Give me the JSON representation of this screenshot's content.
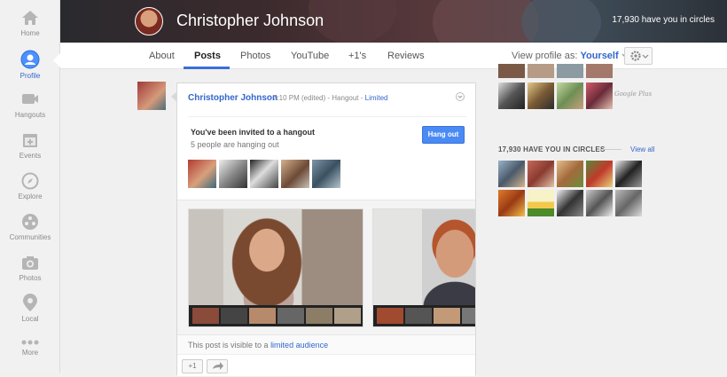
{
  "nav": {
    "items": [
      {
        "label": "Home",
        "icon": "home-icon",
        "active": false
      },
      {
        "label": "Profile",
        "icon": "profile-icon",
        "active": true
      },
      {
        "label": "Hangouts",
        "icon": "hangouts-icon",
        "active": false
      },
      {
        "label": "Events",
        "icon": "events-icon",
        "active": false
      },
      {
        "label": "Explore",
        "icon": "explore-icon",
        "active": false
      },
      {
        "label": "Communities",
        "icon": "communities-icon",
        "active": false
      },
      {
        "label": "Photos",
        "icon": "photos-icon",
        "active": false
      },
      {
        "label": "Local",
        "icon": "local-icon",
        "active": false
      },
      {
        "label": "More",
        "icon": "more-icon",
        "active": false
      }
    ]
  },
  "profile": {
    "name": "Christopher Johnson",
    "circles_count": "17,930 have you in circles"
  },
  "tabs": [
    {
      "label": "About"
    },
    {
      "label": "Posts"
    },
    {
      "label": "Photos"
    },
    {
      "label": "YouTube"
    },
    {
      "label": "+1's"
    },
    {
      "label": "Reviews"
    }
  ],
  "active_tab": "Posts",
  "view_as": {
    "label": "View profile as:",
    "value": "Yourself"
  },
  "post": {
    "author": "Christopher Johnson",
    "time": "7:10 PM (edited)",
    "separator": "-",
    "type": "Hangout",
    "audience": "Limited",
    "invite_title": "You've been invited to a hangout",
    "invite_sub": "5 people are hanging out",
    "hangout_button": "Hang out",
    "visible_prefix": "This post is visible to a",
    "visible_link": "limited audience",
    "plus_one": "+1"
  },
  "right": {
    "in_circles_heading": "17,930 HAVE YOU IN CIRCLES",
    "view_all": "View all",
    "gplus_tag": "Google Plus"
  },
  "colors": {
    "link": "#3366cc",
    "button": "#4a8af4",
    "tab_underline": "#3a6fd8"
  }
}
